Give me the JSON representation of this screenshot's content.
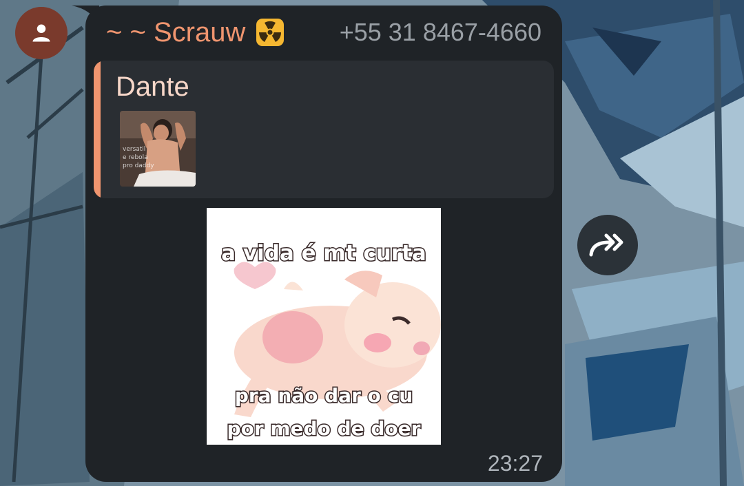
{
  "message": {
    "sender_name": "~ ~ Scrauw",
    "sender_emoji": "radioactive-icon",
    "sender_phone": "+55 31 8467-4660",
    "time": "23:27",
    "reply": {
      "author": "Dante",
      "thumbnail_caption": "versatil e rebola pro daddy"
    },
    "sticker": {
      "top_text": "a vida é mt curta",
      "bottom_line1": "pra não dar o cu",
      "bottom_line2": "por medo de doer"
    }
  },
  "colors": {
    "sender_accent": "#f0956f",
    "bubble": "#1f2327",
    "quote_bg": "#2a2e33",
    "avatar_bg": "#7a3a2c"
  },
  "icons": {
    "avatar": "person-icon",
    "forward": "forward-arrow-icon"
  }
}
